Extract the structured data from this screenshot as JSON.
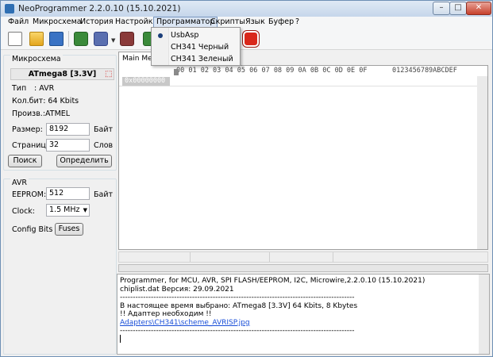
{
  "window": {
    "title": "NeoProgrammer 2.2.0.10 (15.10.2021)",
    "min_glyph": "–",
    "max_glyph": "□",
    "close_glyph": "✕"
  },
  "menu": {
    "items": [
      "Файл",
      "Микросхема",
      "История",
      "Настройки",
      "Программатор",
      "Скрипты",
      "Язык",
      "Буфер",
      "?"
    ]
  },
  "toolbar": {
    "icons": [
      "new-file-icon",
      "open-folder-icon",
      "save-icon",
      "read-chip-icon",
      "write-chip-icon",
      "erase-chip-icon",
      "detect-chip-icon",
      "stop-icon"
    ]
  },
  "programmer_dropdown": {
    "items": [
      "UsbAsp",
      "CH341 Черный",
      "CH341 Зеленый"
    ],
    "selected": "UsbAsp"
  },
  "chip_group": {
    "label": "Микросхема",
    "chip_name": "ATmega8 [3.3V]",
    "type_label": "Тип",
    "type_value": ": AVR",
    "bits_label": "Кол.бит: 64 Kbits",
    "manufacturer_label": "Произв.:ATMEL",
    "size_label": "Размер:",
    "size_value": "8192",
    "size_unit": "Байт",
    "page_label": "Страница:",
    "page_value": "32",
    "page_unit": "Слов",
    "search_button": "Поиск",
    "detect_button": "Определить"
  },
  "avr_group": {
    "label": "AVR",
    "eeprom_label": "EEPROM:",
    "eeprom_value": "512",
    "eeprom_unit": "Байт",
    "clock_label": "Clock:",
    "clock_value": "1.5 MHz",
    "config_label": "Config Bits",
    "fuses_button": "Fuses"
  },
  "editor": {
    "tab_label": "Main Memory",
    "header_cols": "00 01 02 03 04 05 06 07 08 09 0A 0B 0C 0D 0E 0F",
    "header_ascii": "0123456789ABCDEF",
    "address": "0x00000000"
  },
  "log": {
    "line1": "Programmer, for MCU, AVR, SPI FLASH/EEPROM, I2C, Microwire,2.2.0.10 (15.10.2021)",
    "line2": "chiplist.dat Версия: 29.09.2021",
    "sep1": "-------------------------------------------------------------------------------------------",
    "line3": "В настоящее время выбрано:  ATmega8 [3.3V] 64 Kbits, 8 Kbytes",
    "line4": "!! Адаптер необходим !!",
    "line5": "Adapters\\CH341\\scheme_AVRISP.jpg",
    "sep2": "-------------------------------------------------------------------------------------------"
  },
  "colors": {
    "accent": "#7a98c0",
    "link": "#1a4fd8",
    "stop": "#d9281b"
  }
}
